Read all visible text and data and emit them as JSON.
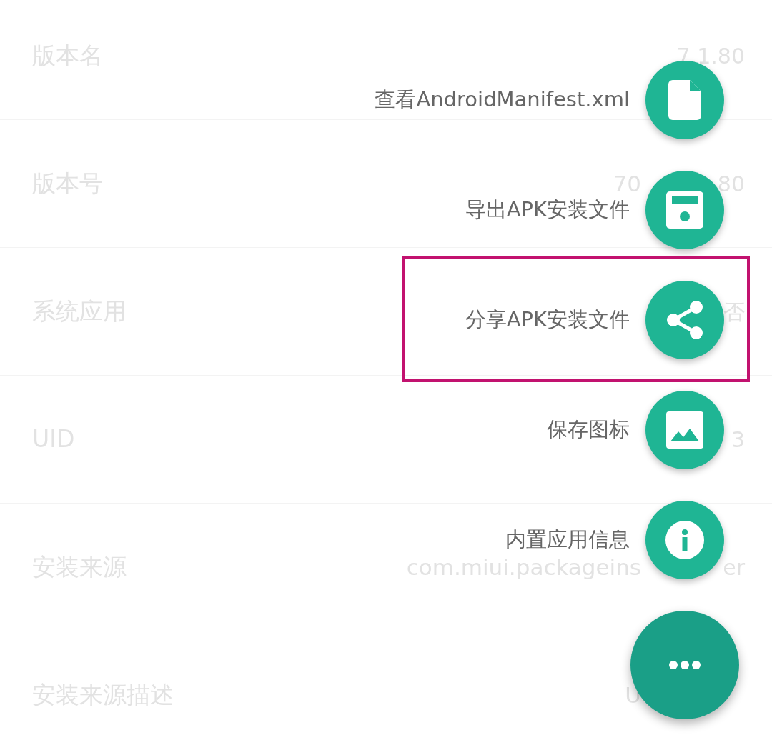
{
  "rows": [
    {
      "label": "版本名",
      "value_end": "7.1.80"
    },
    {
      "label": "版本号",
      "value_start": "70",
      "value_end": "80"
    },
    {
      "label": "系统应用",
      "value_end": "否"
    },
    {
      "label": "UID",
      "value_end": "3"
    },
    {
      "label": "安装来源",
      "value_start": "com.miui.packageins",
      "value_end": "er"
    },
    {
      "label": "安装来源描述",
      "value_start": "U"
    }
  ],
  "fab_menu": {
    "actions": [
      {
        "label": "查看AndroidManifest.xml",
        "kind": "file",
        "highlighted": false
      },
      {
        "label": "导出APK安装文件",
        "kind": "save",
        "highlighted": false
      },
      {
        "label": "分享APK安装文件",
        "kind": "share",
        "highlighted": true
      },
      {
        "label": "保存图标",
        "kind": "image",
        "highlighted": false
      },
      {
        "label": "内置应用信息",
        "kind": "info",
        "highlighted": false
      }
    ]
  }
}
